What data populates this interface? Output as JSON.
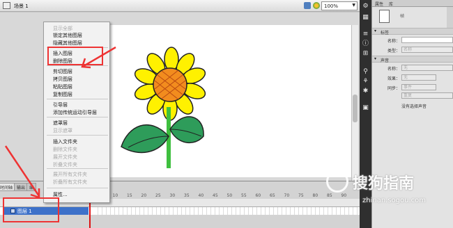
{
  "scene": {
    "label": "场景 1",
    "zoom": "100%"
  },
  "context_menu": {
    "items": [
      {
        "label": "显示全部",
        "enabled": false
      },
      {
        "label": "锁定其他图层",
        "enabled": true
      },
      {
        "label": "隐藏其他图层",
        "enabled": true
      },
      {
        "label": "插入图层",
        "enabled": true
      },
      {
        "label": "删除图层",
        "enabled": true
      },
      {
        "label": "剪切图层",
        "enabled": true
      },
      {
        "label": "拷贝图层",
        "enabled": true
      },
      {
        "label": "粘贴图层",
        "enabled": true
      },
      {
        "label": "复制图层",
        "enabled": true
      },
      {
        "label": "引导层",
        "enabled": true
      },
      {
        "label": "添加传统运动引导层",
        "enabled": true
      },
      {
        "label": "遮罩层",
        "enabled": true
      },
      {
        "label": "显示遮罩",
        "enabled": false
      },
      {
        "label": "插入文件夹",
        "enabled": true
      },
      {
        "label": "删除文件夹",
        "enabled": false
      },
      {
        "label": "展开文件夹",
        "enabled": false
      },
      {
        "label": "折叠文件夹",
        "enabled": false
      },
      {
        "label": "展开所有文件夹",
        "enabled": false
      },
      {
        "label": "折叠所有文件夹",
        "enabled": false
      },
      {
        "label": "属性...",
        "enabled": true
      }
    ]
  },
  "timeline": {
    "tabs": [
      "时间轴",
      "输出",
      "编"
    ],
    "layer_name": "图层 1",
    "frame_ticks": [
      "5",
      "10",
      "15",
      "20",
      "25",
      "30",
      "35",
      "40",
      "45",
      "50",
      "55",
      "60",
      "65",
      "70",
      "75",
      "80",
      "85",
      "90"
    ]
  },
  "properties": {
    "tabs": [
      "属性",
      "库"
    ],
    "doc_type": "帧",
    "label_section": "标签",
    "name_label": "名称：",
    "type_label": "类型：",
    "type_value": "名称",
    "sound_section": "声音",
    "sound_name_label": "名称：",
    "sound_name_value": "无",
    "effect_label": "效果：",
    "effect_value": "无",
    "sync_label": "同步：",
    "sync_value": "事件",
    "repeat_value": "重复",
    "no_sound": "没有选择声音"
  },
  "watermark": {
    "title": "搜狗指南",
    "url": "zhinan.sogou.com"
  },
  "colors": {
    "highlight": "#e33333",
    "petal": "#fff100",
    "center": "#f28c1e",
    "leaf": "#2e9c5a",
    "stem": "#3fbf3f",
    "layer_selected": "#3d71c9"
  }
}
